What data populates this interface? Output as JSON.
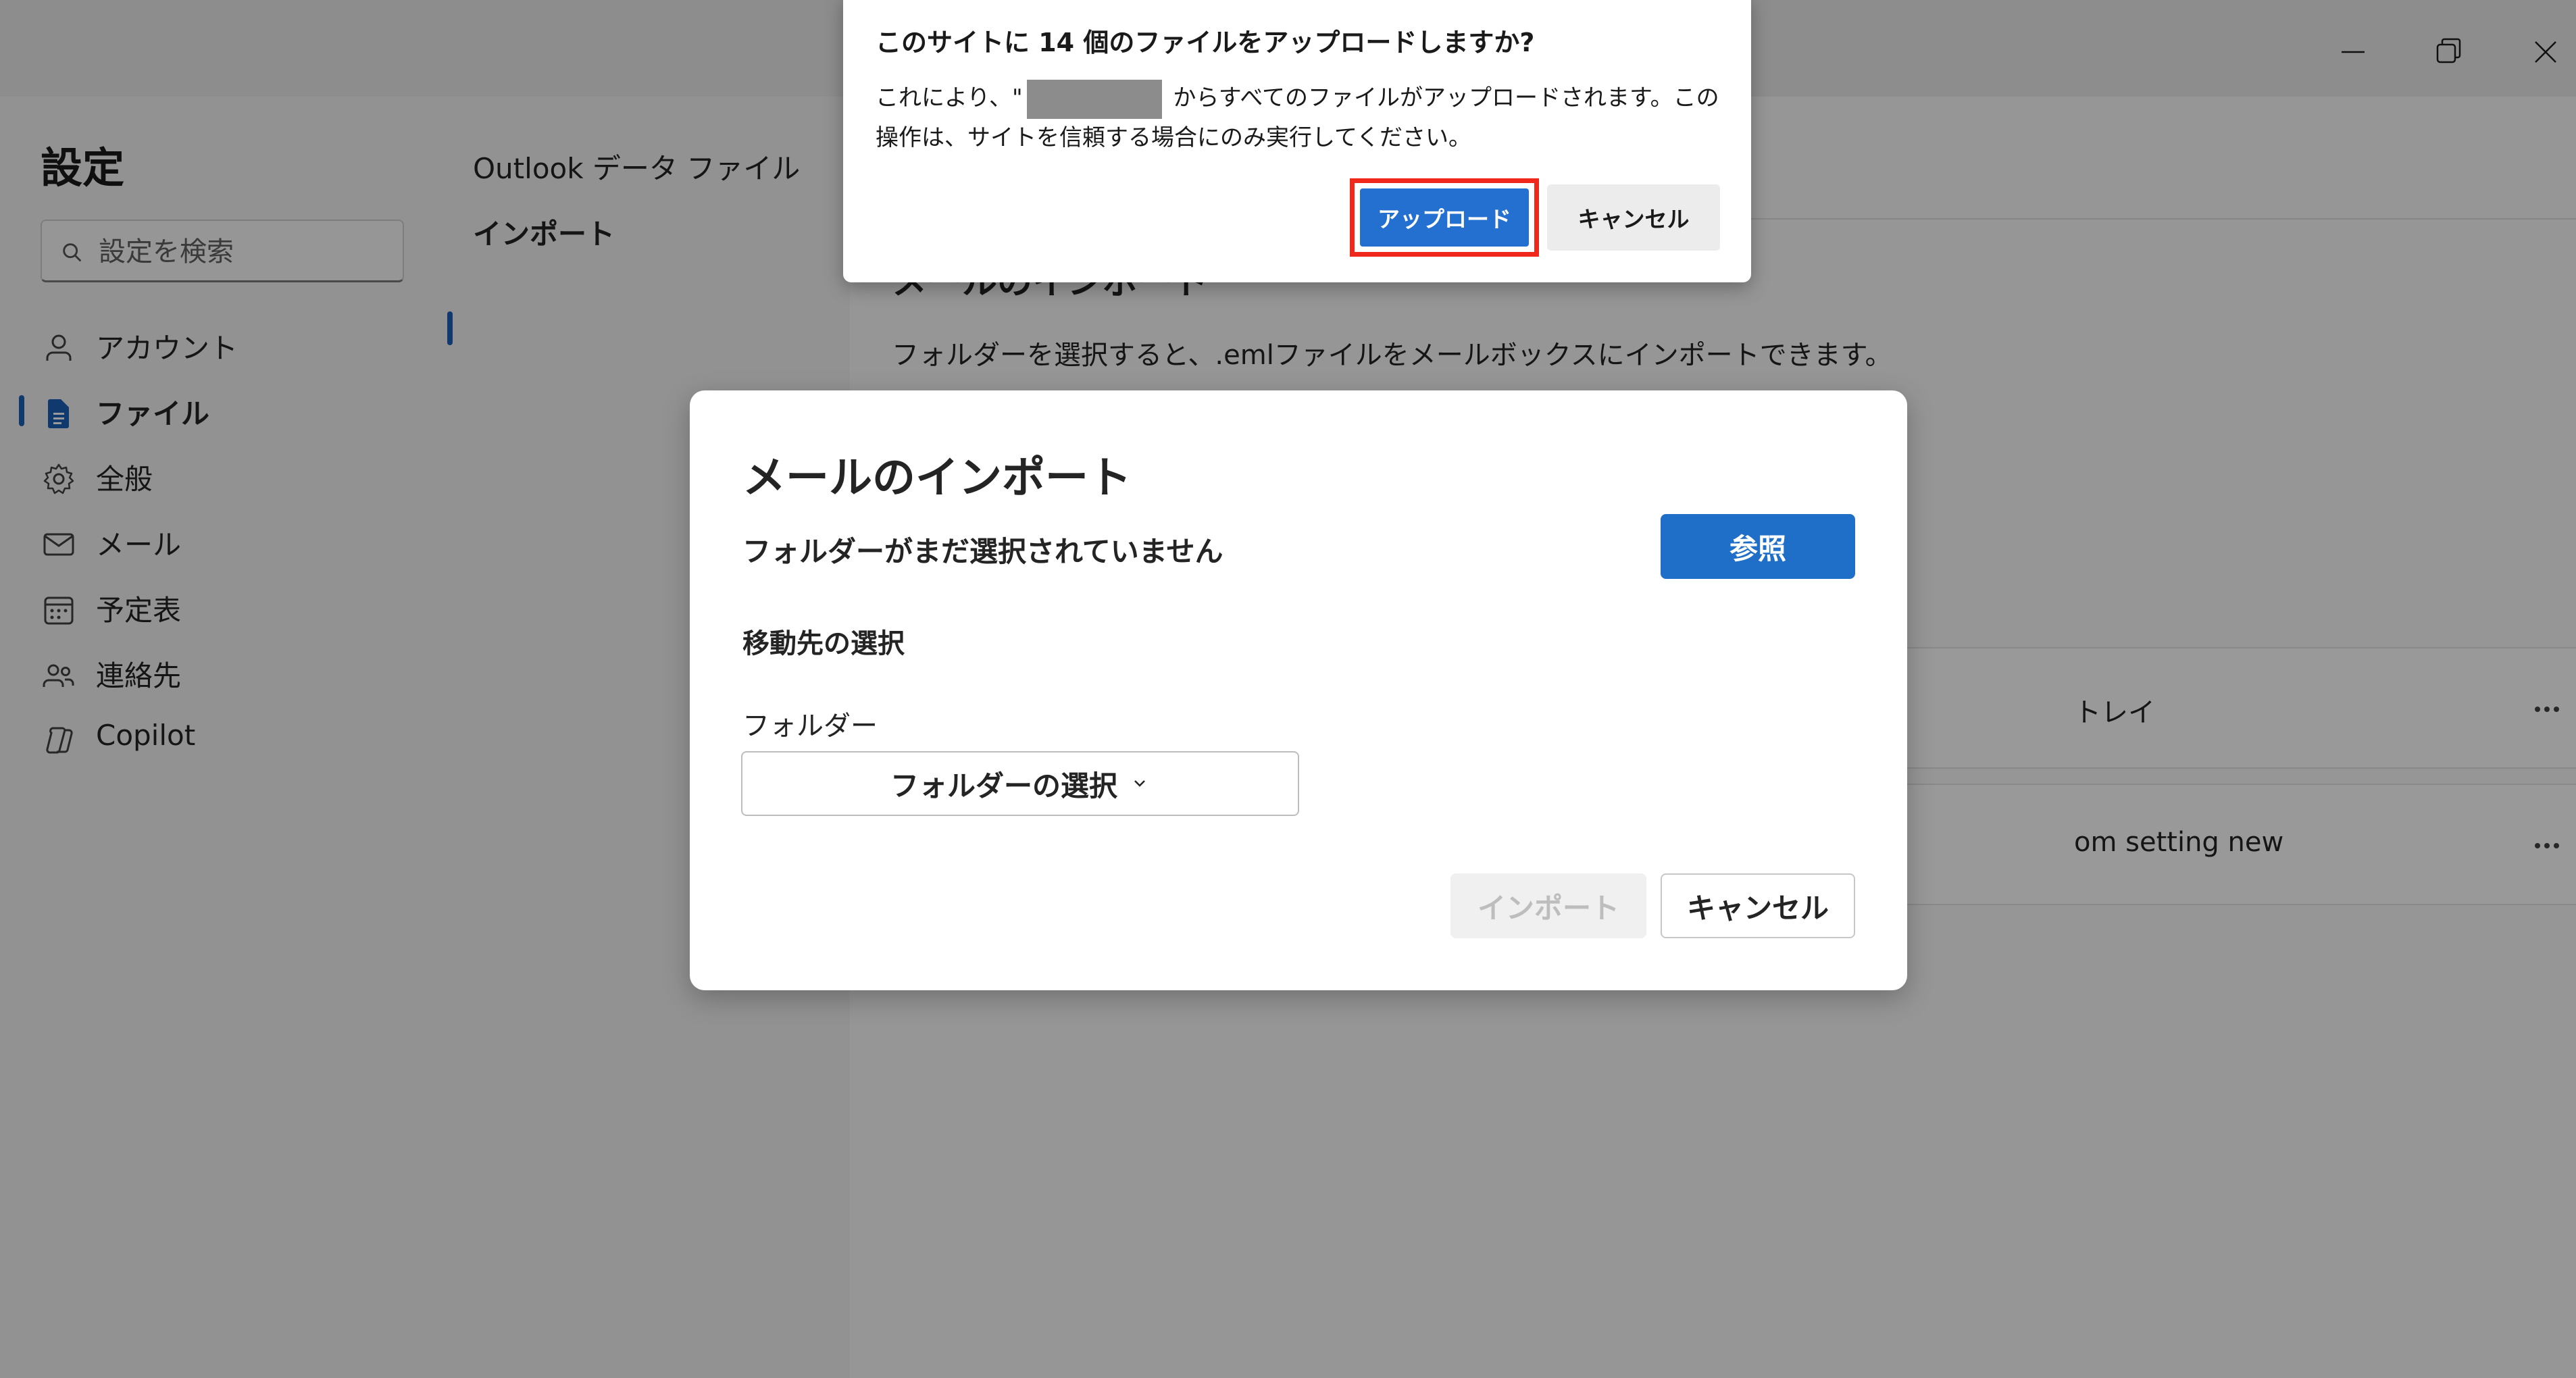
{
  "window": {
    "minimize_icon": "minimize-icon",
    "maximize_icon": "restore-icon",
    "close_icon": "close-icon"
  },
  "nav": {
    "title": "設定",
    "search_placeholder": "設定を検索",
    "items": [
      {
        "label": "アカウント",
        "icon": "person-icon"
      },
      {
        "label": "ファイル",
        "icon": "document-icon",
        "active": true
      },
      {
        "label": "全般",
        "icon": "gear-icon"
      },
      {
        "label": "メール",
        "icon": "mail-icon"
      },
      {
        "label": "予定表",
        "icon": "calendar-icon"
      },
      {
        "label": "連絡先",
        "icon": "people-icon"
      },
      {
        "label": "Copilot",
        "icon": "copilot-icon"
      }
    ]
  },
  "subnav": {
    "items": [
      {
        "label": "Outlook データ ファイル"
      },
      {
        "label": "インポート",
        "active": true
      }
    ]
  },
  "content": {
    "heading": "メールのインポート",
    "description": "フォルダーを選択すると、.emlファイルをメールボックスにインポートできます。",
    "rules": [
      {
        "label": "トレイ"
      },
      {
        "label": "om setting new"
      }
    ]
  },
  "dialog": {
    "title": "メールのインポート",
    "status": "フォルダーがまだ選択されていません",
    "browse_label": "参照",
    "destination_heading": "移動先の選択",
    "folder_label": "フォルダー",
    "folder_select_label": "フォルダーの選択",
    "import_label": "インポート",
    "cancel_label": "キャンセル"
  },
  "upload_prompt": {
    "title": "このサイトに 14 個のファイルをアップロードしますか?",
    "body_prefix": "これにより、\"",
    "body_suffix": " からすべてのファイルがアップロードされます。この操作は、サイトを信頼する場合にのみ実行してください。",
    "upload_label": "アップロード",
    "cancel_label": "キャンセル"
  },
  "colors": {
    "accent": "#1f6fc9",
    "highlight_border": "#f0281b"
  }
}
